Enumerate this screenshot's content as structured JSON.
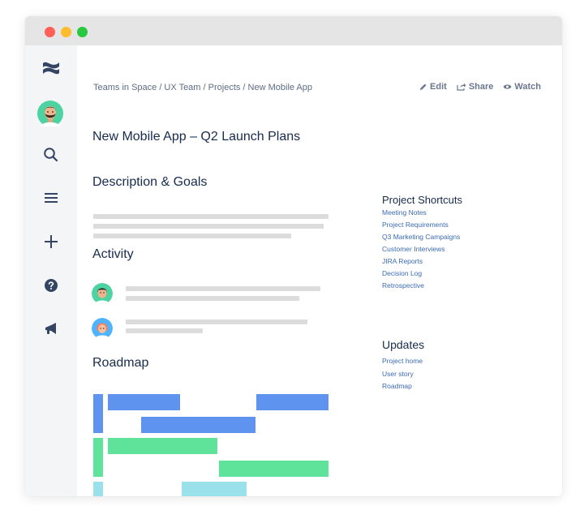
{
  "window": {
    "controls": [
      "close",
      "minimize",
      "maximize"
    ],
    "control_colors": {
      "close": "#fe5f57",
      "minimize": "#febc2e",
      "maximize": "#28c840"
    }
  },
  "sidebar": {
    "icons": [
      "confluence-logo-icon",
      "avatar",
      "search-icon",
      "menu-icon",
      "add-icon",
      "help-icon",
      "notifications-icon"
    ]
  },
  "breadcrumb": {
    "text": "Teams in Space / UX Team / Projects / New Mobile App"
  },
  "actions": {
    "edit_label": "Edit",
    "share_label": "Share",
    "watch_label": "Watch"
  },
  "page": {
    "title": "New Mobile App – Q2 Launch Plans"
  },
  "sections": {
    "description_title": "Description & Goals",
    "activity_title": "Activity",
    "roadmap_title": "Roadmap"
  },
  "shortcuts": {
    "title": "Project Shortcuts",
    "links": [
      "Meeting Notes",
      "Project Requirements",
      "Q3 Marketing Campaigns",
      "Customer Interviews",
      "JIRA Reports",
      "Decision Log",
      "Retrospective"
    ]
  },
  "updates": {
    "title": "Updates",
    "links": [
      "Project home",
      "User story",
      "Roadmap"
    ]
  },
  "colors": {
    "roadmap_blue": "#5e94f0",
    "roadmap_green": "#5fe39a",
    "roadmap_cyan": "#9be1ec",
    "link": "#3b6bb5",
    "text": "#172b4d"
  }
}
